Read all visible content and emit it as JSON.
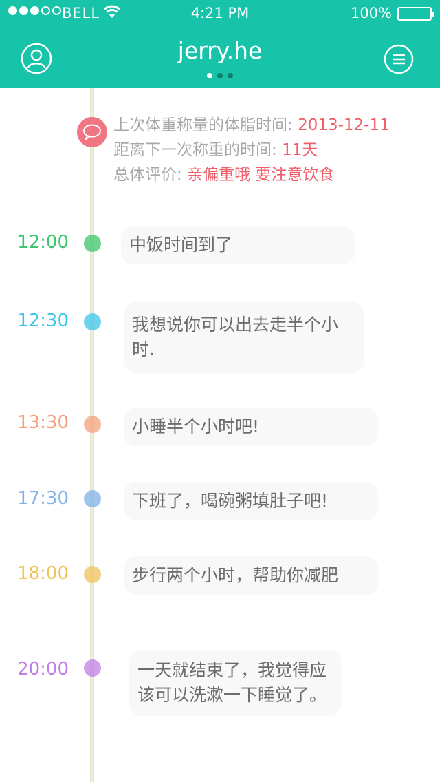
{
  "status_bar": {
    "carrier": "BELL",
    "time": "4:21 PM",
    "battery": "100%",
    "signal_strength": 3
  },
  "header": {
    "title": "jerry.he",
    "page_count": 3,
    "active_page": 1,
    "color": "#17c3a9"
  },
  "summary": {
    "last_weigh_label": "上次体重称量的体脂时间:",
    "last_weigh_value": "2013-12-11",
    "next_weigh_label": "距离下一次称重的时间:",
    "next_weigh_value": "11天",
    "evaluation_label": "总体评价:",
    "evaluation_value": "亲偏重哦  要注意饮食"
  },
  "entries": [
    {
      "time": "12:00",
      "text": "中饭时间到了",
      "color": "#39c66c"
    },
    {
      "time": "12:30",
      "text": "我想说你可以出去走半个小时.",
      "color": "#3cc6ea"
    },
    {
      "time": "13:30",
      "text": "小睡半个小时吧!",
      "color": "#f6a07a"
    },
    {
      "time": "17:30",
      "text": "下班了，喝碗粥填肚子吧!",
      "color": "#7fb1ea"
    },
    {
      "time": "18:00",
      "text": "步行两个小时，帮助你减肥",
      "color": "#f0c35a"
    },
    {
      "time": "20:00",
      "text": "一天就结束了，我觉得应该可以洗漱一下睡觉了。",
      "color": "#c07ee6"
    }
  ]
}
